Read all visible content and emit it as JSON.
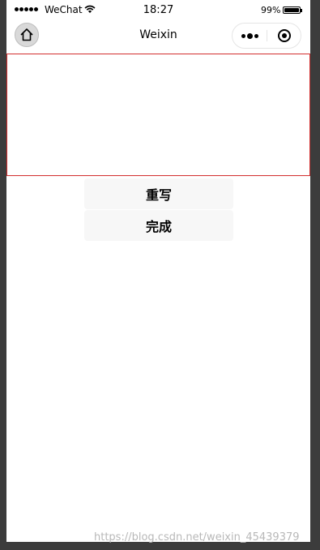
{
  "status_bar": {
    "carrier": "WeChat",
    "time": "18:27",
    "battery": "99%"
  },
  "nav": {
    "title": "Weixin"
  },
  "icons": {
    "home": "home-icon",
    "more": "more-dots-icon",
    "close": "close-target-icon",
    "wifi": "wifi-icon",
    "battery": "battery-icon"
  },
  "buttons": {
    "rewrite": "重写",
    "done": "完成"
  },
  "canvas": {
    "border_color": "#d32f2f"
  },
  "watermark": "https://blog.csdn.net/weixin_45439379"
}
